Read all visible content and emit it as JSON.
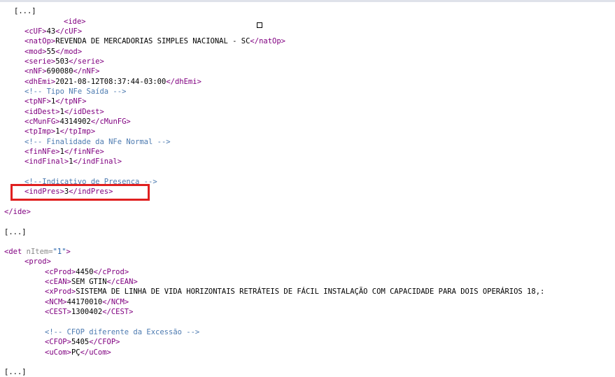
{
  "lines": {
    "l0": "[...]",
    "l1": "<ide>",
    "l2": {
      "a": "<cUF>",
      "b": "43",
      "c": "</cUF>"
    },
    "l3": {
      "a": "<natOp>",
      "b": "REVENDA DE MERCADORIAS SIMPLES NACIONAL - SC",
      "c": "</natOp>"
    },
    "l4": {
      "a": "<mod>",
      "b": "55",
      "c": "</mod>"
    },
    "l5": {
      "a": "<serie>",
      "b": "503",
      "c": "</serie>"
    },
    "l6": {
      "a": "<nNF>",
      "b": "690080",
      "c": "</nNF>"
    },
    "l7": {
      "a": "<dhEmi>",
      "b": "2021-08-12T08:37:44-03:00",
      "c": "</dhEmi>"
    },
    "l8": "<!-- Tipo NFe Saída -->",
    "l9": {
      "a": "<tpNF>",
      "b": "1",
      "c": "</tpNF>"
    },
    "l10": {
      "a": "<idDest>",
      "b": "1",
      "c": "</idDest>"
    },
    "l11": {
      "a": "<cMunFG>",
      "b": "4314902",
      "c": "</cMunFG>"
    },
    "l12": {
      "a": "<tpImp>",
      "b": "1",
      "c": "</tpImp>"
    },
    "l13": "<!-- Finalidade da NFe Normal -->",
    "l14": {
      "a": "<finNFe>",
      "b": "1",
      "c": "</finNFe>"
    },
    "l15": {
      "a": "<indFinal>",
      "b": "1",
      "c": "</indFinal>"
    },
    "l16": "<!--Indicativo de Presença -->",
    "l17": {
      "a": "<indPres>",
      "b": "3",
      "c": "</indPres>"
    },
    "l18": "</ide>",
    "l19": "[...]",
    "l20": {
      "a": "<det",
      "attr": " nItem=",
      "val": "\"1\"",
      "close": ">"
    },
    "l21": "<prod>",
    "l22": {
      "a": "<cProd>",
      "b": "4450",
      "c": "</cProd>"
    },
    "l23": {
      "a": "<cEAN>",
      "b": "SEM GTIN",
      "c": "</cEAN>"
    },
    "l24": {
      "a": "<xProd>",
      "b": "SISTEMA DE LINHA DE VIDA HORIZONTAIS RETRÁTEIS DE FÁCIL INSTALAÇÃO COM CAPACIDADE PARA DOIS OPERÁRIOS 18,:"
    },
    "l25": {
      "a": "<NCM>",
      "b": "44170010",
      "c": "</NCM>"
    },
    "l26": {
      "a": "<CEST>",
      "b": "1300402",
      "c": "</CEST>"
    },
    "l27": "<!-- CFOP diferente da Excessão -->",
    "l28": {
      "a": "<CFOP>",
      "b": "5405",
      "c": "</CFOP>"
    },
    "l29": {
      "a": "<uCom>",
      "b": "PÇ",
      "c": "</uCom>"
    },
    "l30": "[...]"
  },
  "colors": {
    "tag": "#800080",
    "comment": "#4c7ab0",
    "attribute": "#8a8a8a",
    "attribute_value": "#1a5aa6",
    "highlight_border": "#e02020"
  }
}
